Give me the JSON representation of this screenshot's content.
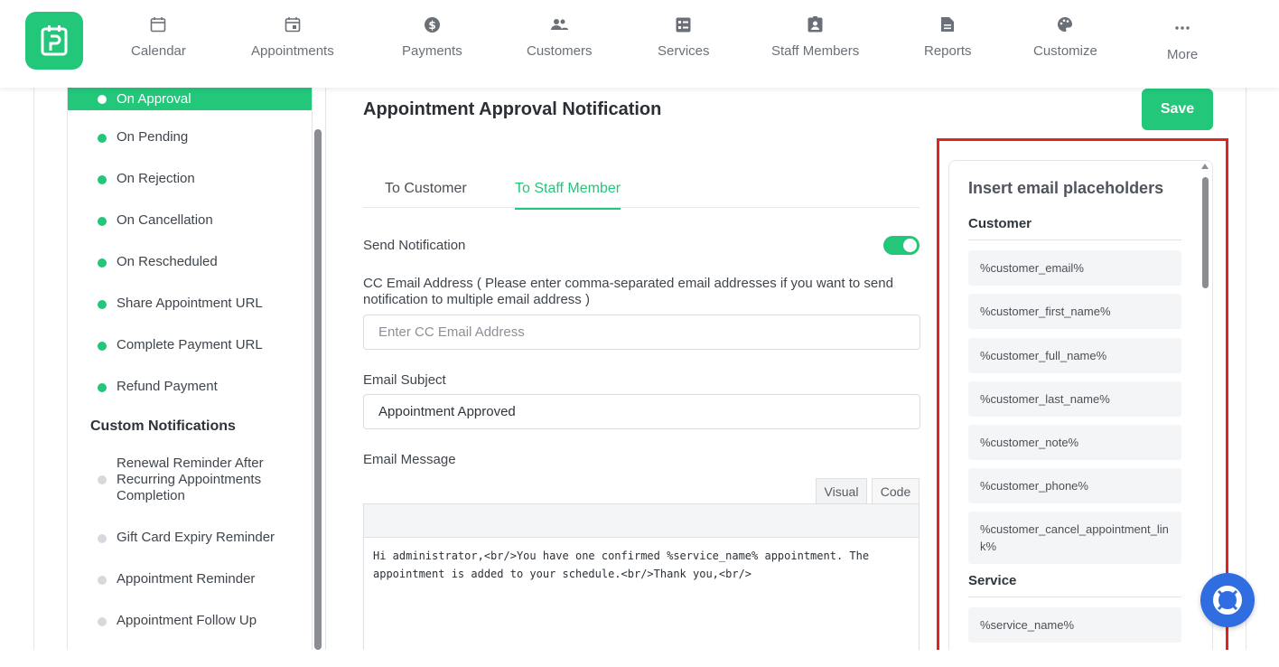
{
  "nav": {
    "items": [
      {
        "label": "Calendar",
        "icon": "calendar-icon"
      },
      {
        "label": "Appointments",
        "icon": "appointments-icon"
      },
      {
        "label": "Payments",
        "icon": "dollar-icon"
      },
      {
        "label": "Customers",
        "icon": "users-icon"
      },
      {
        "label": "Services",
        "icon": "services-icon"
      },
      {
        "label": "Staff Members",
        "icon": "staff-icon"
      },
      {
        "label": "Reports",
        "icon": "reports-icon"
      },
      {
        "label": "Customize",
        "icon": "palette-icon"
      },
      {
        "label": "More",
        "icon": "more-icon"
      }
    ]
  },
  "sidebar": {
    "items": [
      "On Approval",
      "On Pending",
      "On Rejection",
      "On Cancellation",
      "On Rescheduled",
      "Share Appointment URL",
      "Complete Payment URL",
      "Refund Payment"
    ],
    "custom_title": "Custom Notifications",
    "custom_items": [
      "Renewal Reminder After Recurring Appointments Completion",
      "Gift Card Expiry Reminder",
      "Appointment Reminder",
      "Appointment Follow Up"
    ]
  },
  "main": {
    "title": "Appointment Approval Notification",
    "save_label": "Save",
    "tabs": [
      "To Customer",
      "To Staff Member"
    ],
    "active_tab": "To Staff Member",
    "send_notification_label": "Send Notification",
    "send_notification_on": true,
    "cc_label": "CC Email Address ( Please enter comma-separated email addresses if you want to send notification to multiple email address )",
    "cc_placeholder": "Enter CC Email Address",
    "cc_value": "",
    "subject_label": "Email Subject",
    "subject_value": "Appointment Approved",
    "message_label": "Email Message",
    "editor_tabs": [
      "Visual",
      "Code"
    ],
    "message_value": "Hi administrator,<br/>You have one confirmed %service_name% appointment. The appointment is added to your schedule.<br/>Thank you,<br/>"
  },
  "placeholders": {
    "title": "Insert email placeholders",
    "groups": [
      {
        "name": "Customer",
        "items": [
          "%customer_email%",
          "%customer_first_name%",
          "%customer_full_name%",
          "%customer_last_name%",
          "%customer_note%",
          "%customer_phone%",
          "%customer_cancel_appointment_link%"
        ]
      },
      {
        "name": "Service",
        "items": [
          "%service_name%"
        ]
      }
    ]
  },
  "colors": {
    "accent": "#22c77a",
    "highlight_box": "#e02424",
    "help_button": "#2f6de0"
  }
}
